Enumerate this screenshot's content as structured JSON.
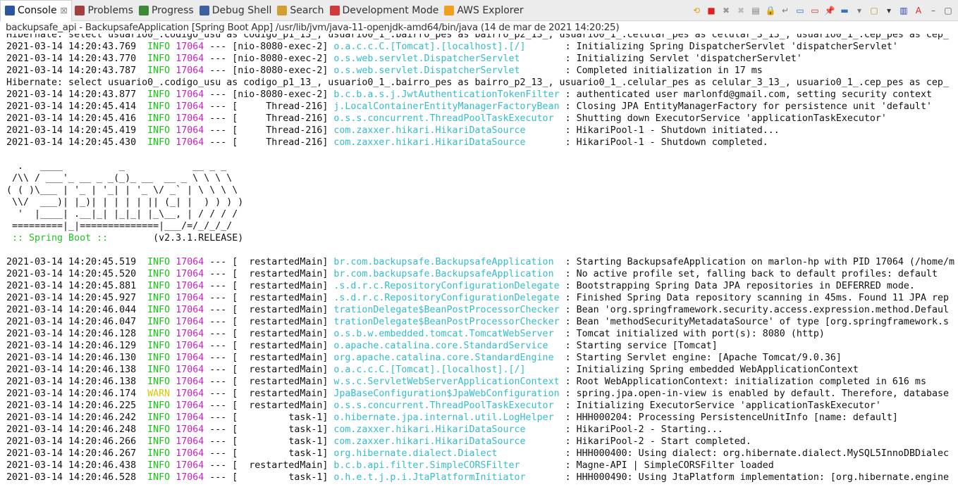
{
  "tabs": [
    {
      "label": "Console",
      "icon": "console-icon",
      "active": true,
      "color": "#2a55a0"
    },
    {
      "label": "Problems",
      "icon": "problems-icon",
      "color": "#a04040"
    },
    {
      "label": "Progress",
      "icon": "progress-icon",
      "color": "#3a8a3a"
    },
    {
      "label": "Debug Shell",
      "icon": "debug-shell-icon",
      "color": "#4060a0"
    },
    {
      "label": "Search",
      "icon": "search-icon",
      "color": "#d0a030"
    },
    {
      "label": "Development Mode",
      "icon": "development-mode-icon",
      "color": "#d03a3a"
    },
    {
      "label": "AWS Explorer",
      "icon": "aws-explorer-icon",
      "color": "#f0a020"
    }
  ],
  "close_glyph": "☒",
  "toolbar": [
    {
      "name": "relaunch-icon",
      "glyph": "⟲",
      "color": "#e0a020"
    },
    {
      "name": "terminate-icon",
      "glyph": "■",
      "color": "#e02020"
    },
    {
      "name": "remove-launch-icon",
      "glyph": "✖",
      "color": "#999"
    },
    {
      "name": "remove-all-icon",
      "glyph": "✖",
      "color": "#bbb"
    },
    {
      "name": "clear-console-icon",
      "glyph": "▤",
      "color": "#777"
    },
    {
      "name": "scroll-lock-icon",
      "glyph": "🔒",
      "color": "#c09020"
    },
    {
      "name": "word-wrap-icon",
      "glyph": "↵",
      "color": "#777"
    },
    {
      "name": "show-on-stdout-icon",
      "glyph": "▭",
      "color": "#3a70c0"
    },
    {
      "name": "show-on-stderr-icon",
      "glyph": "▭",
      "color": "#c03a3a"
    },
    {
      "name": "pin-console-icon",
      "glyph": "📌",
      "color": "#3a9a3a"
    },
    {
      "name": "display-console-icon",
      "glyph": "▬",
      "color": "#3a70c0"
    },
    {
      "name": "display-dropdown-icon",
      "glyph": "▾",
      "color": "#777"
    },
    {
      "name": "new-console-icon",
      "glyph": "▢",
      "color": "#c09020"
    },
    {
      "name": "new-console-dropdown-icon",
      "glyph": "▾",
      "color": "#333"
    },
    {
      "name": "console-settings-icon",
      "glyph": "▥",
      "color": "#2040c0"
    },
    {
      "name": "ascii-icon",
      "glyph": "A",
      "color": "#e02020"
    },
    {
      "name": "minimize-icon",
      "glyph": "–",
      "color": "#555"
    },
    {
      "name": "maximize-icon",
      "glyph": "▢",
      "color": "#555"
    }
  ],
  "description": "backupsafe_api - BackupsafeApplication [Spring Boot App] /usr/lib/jvm/java-11-openjdk-amd64/bin/java  (14 de mar de 2021 14:20:25)",
  "lines": [
    {
      "plain": "Hibernate: select usuario0_.codigo_usu as codigo_p1_13_, usuario0_1_.bairro_pes as bairro_p2_13_, usuario0_1_.celular_pes as celular_3_13_, usuario0_1_.cep_pes as cep_"
    },
    {
      "ts": "2021-03-14 14:20:43.769",
      "level": "INFO",
      "pid": "17064",
      "thread": "nio-8080-exec-2",
      "logger": "o.a.c.c.C.[Tomcat].[localhost].[/]",
      "msg": "Initializing Spring DispatcherServlet 'dispatcherServlet'"
    },
    {
      "ts": "2021-03-14 14:20:43.770",
      "level": "INFO",
      "pid": "17064",
      "thread": "nio-8080-exec-2",
      "logger": "o.s.web.servlet.DispatcherServlet",
      "msg": "Initializing Servlet 'dispatcherServlet'"
    },
    {
      "ts": "2021-03-14 14:20:43.787",
      "level": "INFO",
      "pid": "17064",
      "thread": "nio-8080-exec-2",
      "logger": "o.s.web.servlet.DispatcherServlet",
      "msg": "Completed initialization in 17 ms"
    },
    {
      "plain": "Hibernate: select usuario0_.codigo_usu as codigo_p1_13_, usuario0_1_.bairro_pes as bairro_p2_13_, usuario0_1_.celular_pes as celular_3_13_, usuario0_1_.cep_pes as cep_"
    },
    {
      "ts": "2021-03-14 14:20:43.877",
      "level": "INFO",
      "pid": "17064",
      "thread": "nio-8080-exec-2",
      "logger": "b.c.b.a.s.j.JwtAuthenticationTokenFilter",
      "msg": "authenticated user marlonfd@gmail.com, setting security context"
    },
    {
      "ts": "2021-03-14 14:20:45.414",
      "level": "INFO",
      "pid": "17064",
      "thread": "Thread-216",
      "logger": "j.LocalContainerEntityManagerFactoryBean",
      "msg": "Closing JPA EntityManagerFactory for persistence unit 'default'"
    },
    {
      "ts": "2021-03-14 14:20:45.416",
      "level": "INFO",
      "pid": "17064",
      "thread": "Thread-216",
      "logger": "o.s.s.concurrent.ThreadPoolTaskExecutor",
      "msg": "Shutting down ExecutorService 'applicationTaskExecutor'"
    },
    {
      "ts": "2021-03-14 14:20:45.419",
      "level": "INFO",
      "pid": "17064",
      "thread": "Thread-216",
      "logger": "com.zaxxer.hikari.HikariDataSource",
      "msg": "HikariPool-1 - Shutdown initiated..."
    },
    {
      "ts": "2021-03-14 14:20:45.430",
      "level": "INFO",
      "pid": "17064",
      "thread": "Thread-216",
      "logger": "com.zaxxer.hikari.HikariDataSource",
      "msg": "HikariPool-1 - Shutdown completed."
    },
    {
      "plain": ""
    },
    {
      "plain": "  .   ____          _            __ _ _"
    },
    {
      "plain": " /\\\\ / ___'_ __ _ _(_)_ __  __ _ \\ \\ \\ \\"
    },
    {
      "plain": "( ( )\\___ | '_ | '_| | '_ \\/ _` | \\ \\ \\ \\"
    },
    {
      "plain": " \\\\/  ___)| |_)| | | | | || (_| |  ) ) ) )"
    },
    {
      "plain": "  '  |____| .__|_| |_|_| |_\\__, | / / / /"
    },
    {
      "plain": " =========|_|==============|___/=/_/_/_/"
    },
    {
      "boot": " :: Spring Boot :: ",
      "version": "       (v2.3.1.RELEASE)"
    },
    {
      "plain": ""
    },
    {
      "ts": "2021-03-14 14:20:45.519",
      "level": "INFO",
      "pid": "17064",
      "thread": "restartedMain",
      "logger": "br.com.backupsafe.BackupsafeApplication",
      "msg": "Starting BackupsafeApplication on marlon-hp with PID 17064 (/home/m"
    },
    {
      "ts": "2021-03-14 14:20:45.520",
      "level": "INFO",
      "pid": "17064",
      "thread": "restartedMain",
      "logger": "br.com.backupsafe.BackupsafeApplication",
      "msg": "No active profile set, falling back to default profiles: default"
    },
    {
      "ts": "2021-03-14 14:20:45.881",
      "level": "INFO",
      "pid": "17064",
      "thread": "restartedMain",
      "logger": ".s.d.r.c.RepositoryConfigurationDelegate",
      "msg": "Bootstrapping Spring Data JPA repositories in DEFERRED mode."
    },
    {
      "ts": "2021-03-14 14:20:45.927",
      "level": "INFO",
      "pid": "17064",
      "thread": "restartedMain",
      "logger": ".s.d.r.c.RepositoryConfigurationDelegate",
      "msg": "Finished Spring Data repository scanning in 45ms. Found 11 JPA rep"
    },
    {
      "ts": "2021-03-14 14:20:46.044",
      "level": "INFO",
      "pid": "17064",
      "thread": "restartedMain",
      "logger": "trationDelegate$BeanPostProcessorChecker",
      "msg": "Bean 'org.springframework.security.access.expression.method.Defaul"
    },
    {
      "ts": "2021-03-14 14:20:46.047",
      "level": "INFO",
      "pid": "17064",
      "thread": "restartedMain",
      "logger": "trationDelegate$BeanPostProcessorChecker",
      "msg": "Bean 'methodSecurityMetadataSource' of type [org.springframework.s"
    },
    {
      "ts": "2021-03-14 14:20:46.128",
      "level": "INFO",
      "pid": "17064",
      "thread": "restartedMain",
      "logger": "o.s.b.w.embedded.tomcat.TomcatWebServer",
      "msg": "Tomcat initialized with port(s): 8080 (http)"
    },
    {
      "ts": "2021-03-14 14:20:46.129",
      "level": "INFO",
      "pid": "17064",
      "thread": "restartedMain",
      "logger": "o.apache.catalina.core.StandardService",
      "msg": "Starting service [Tomcat]"
    },
    {
      "ts": "2021-03-14 14:20:46.130",
      "level": "INFO",
      "pid": "17064",
      "thread": "restartedMain",
      "logger": "org.apache.catalina.core.StandardEngine",
      "msg": "Starting Servlet engine: [Apache Tomcat/9.0.36]"
    },
    {
      "ts": "2021-03-14 14:20:46.138",
      "level": "INFO",
      "pid": "17064",
      "thread": "restartedMain",
      "logger": "o.a.c.c.C.[Tomcat].[localhost].[/]",
      "msg": "Initializing Spring embedded WebApplicationContext"
    },
    {
      "ts": "2021-03-14 14:20:46.138",
      "level": "INFO",
      "pid": "17064",
      "thread": "restartedMain",
      "logger": "w.s.c.ServletWebServerApplicationContext",
      "msg": "Root WebApplicationContext: initialization completed in 616 ms"
    },
    {
      "ts": "2021-03-14 14:20:46.174",
      "level": "WARN",
      "pid": "17064",
      "thread": "restartedMain",
      "logger": "JpaBaseConfiguration$JpaWebConfiguration",
      "msg": "spring.jpa.open-in-view is enabled by default. Therefore, database"
    },
    {
      "ts": "2021-03-14 14:20:46.225",
      "level": "INFO",
      "pid": "17064",
      "thread": "restartedMain",
      "logger": "o.s.s.concurrent.ThreadPoolTaskExecutor",
      "msg": "Initializing ExecutorService 'applicationTaskExecutor'"
    },
    {
      "ts": "2021-03-14 14:20:46.242",
      "level": "INFO",
      "pid": "17064",
      "thread": "task-1",
      "logger": "o.hibernate.jpa.internal.util.LogHelper",
      "msg": "HHH000204: Processing PersistenceUnitInfo [name: default]"
    },
    {
      "ts": "2021-03-14 14:20:46.248",
      "level": "INFO",
      "pid": "17064",
      "thread": "task-1",
      "logger": "com.zaxxer.hikari.HikariDataSource",
      "msg": "HikariPool-2 - Starting..."
    },
    {
      "ts": "2021-03-14 14:20:46.266",
      "level": "INFO",
      "pid": "17064",
      "thread": "task-1",
      "logger": "com.zaxxer.hikari.HikariDataSource",
      "msg": "HikariPool-2 - Start completed."
    },
    {
      "ts": "2021-03-14 14:20:46.267",
      "level": "INFO",
      "pid": "17064",
      "thread": "task-1",
      "logger": "org.hibernate.dialect.Dialect",
      "msg": "HHH000400: Using dialect: org.hibernate.dialect.MySQL5InnoDBDialec"
    },
    {
      "ts": "2021-03-14 14:20:46.438",
      "level": "INFO",
      "pid": "17064",
      "thread": "restartedMain",
      "logger": "b.c.b.api.filter.SimpleCORSFilter",
      "msg": "Magne-API | SimpleCORSFilter loaded"
    },
    {
      "ts": "2021-03-14 14:20:46.528",
      "level": "INFO",
      "pid": "17064",
      "thread": "task-1",
      "logger": "o.h.e.t.j.p.i.JtaPlatformInitiator",
      "msg": "HHH000490: Using JtaPlatform implementation: [org.hibernate.engine"
    }
  ],
  "colors": {
    "info": "#16c316",
    "warn": "#d6c800",
    "pid": "#c61fc6",
    "logger": "#33bccb"
  }
}
